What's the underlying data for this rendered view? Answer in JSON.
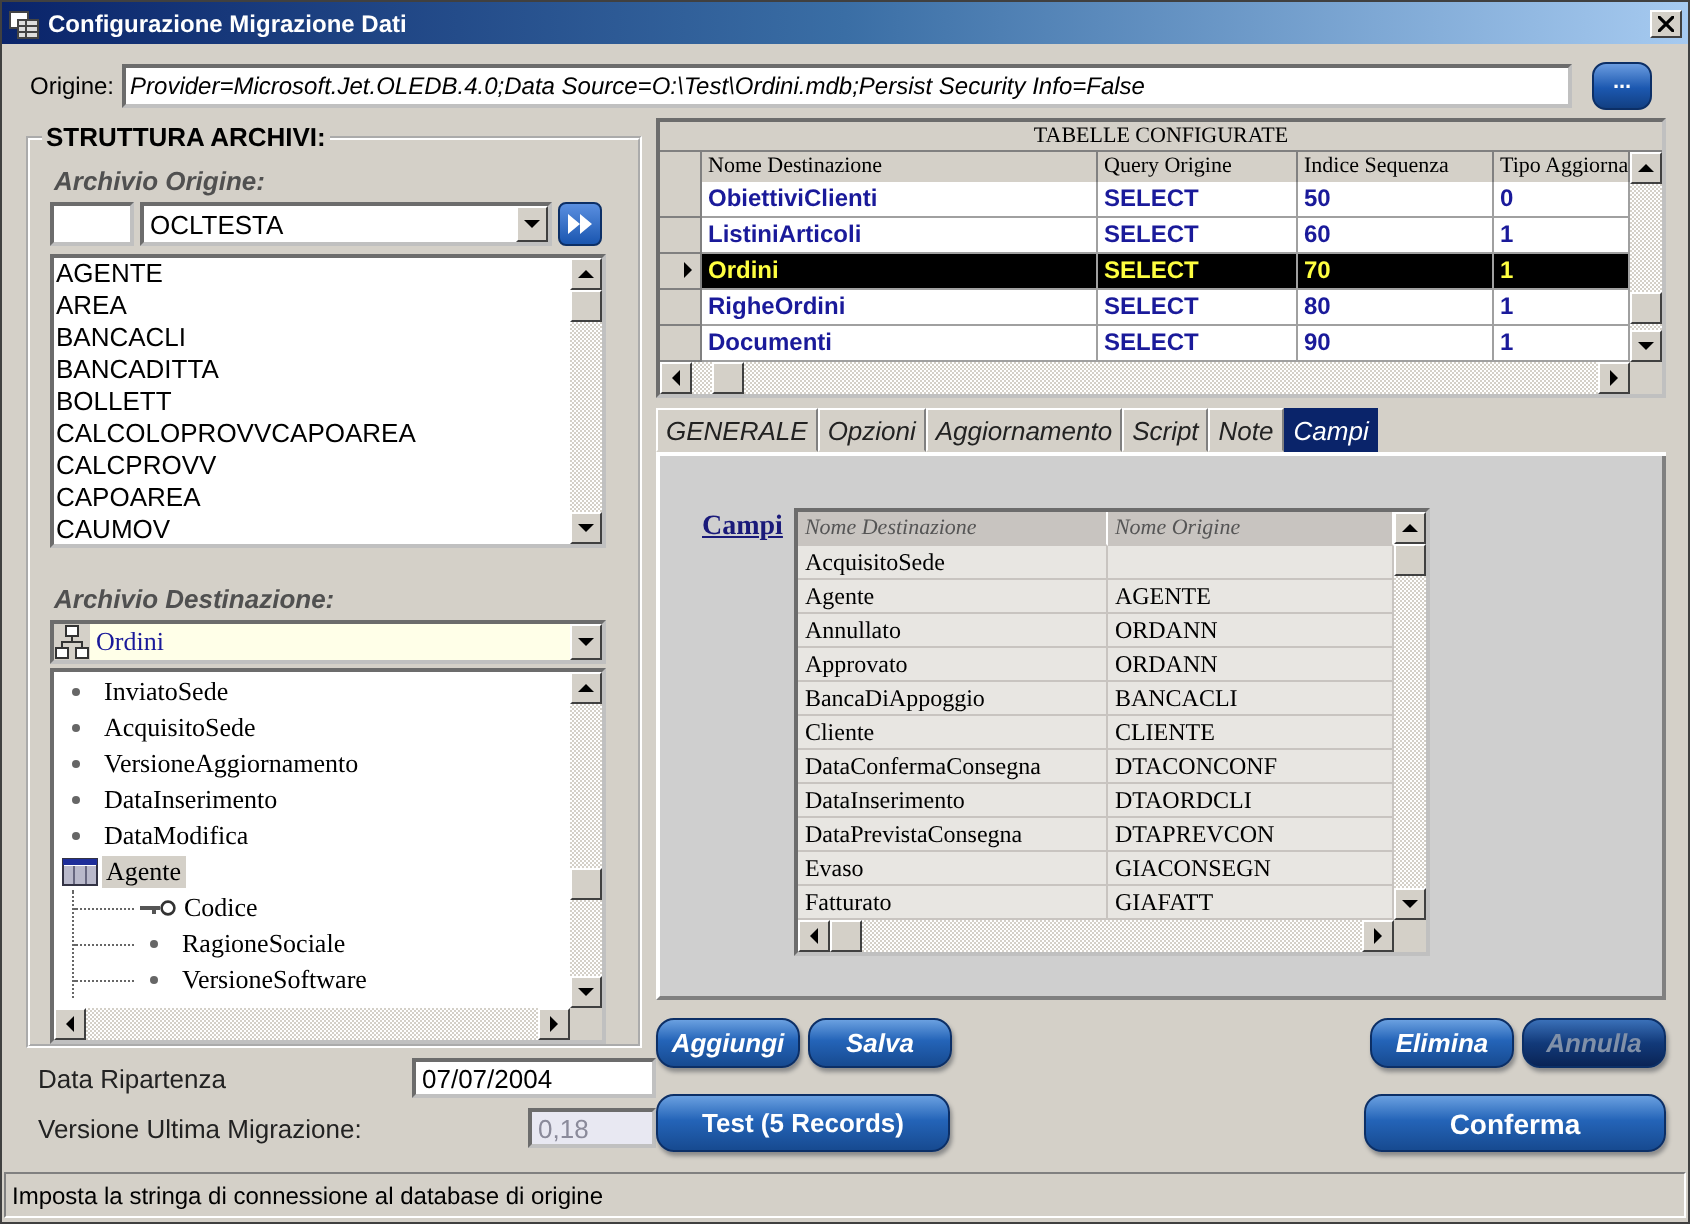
{
  "window": {
    "title": "Configurazione Migrazione Dati"
  },
  "origine": {
    "label": "Origine:",
    "value": "Provider=Microsoft.Jet.OLEDB.4.0;Data Source=O:\\Test\\Ordini.mdb;Persist Security Info=False",
    "button": "..."
  },
  "struttura": {
    "title": "STRUTTURA ARCHIVI:",
    "origine": {
      "label": "Archivio Origine:",
      "combo": "OCLTESTA",
      "items": [
        "AGENTE",
        "AREA",
        "BANCACLI",
        "BANCADITTA",
        "BOLLETT",
        "CALCOLOPROVVCAPOAREA",
        "CALCPROVV",
        "CAPOAREA",
        "CAUMOV"
      ]
    },
    "destinazione": {
      "label": "Archivio Destinazione:",
      "combo": "Ordini",
      "tree": [
        {
          "kind": "field",
          "label": "InviatoSede",
          "selected": false
        },
        {
          "kind": "field",
          "label": "AcquisitoSede",
          "selected": false
        },
        {
          "kind": "field",
          "label": "VersioneAggiornamento",
          "selected": false
        },
        {
          "kind": "field",
          "label": "DataInserimento",
          "selected": false
        },
        {
          "kind": "field",
          "label": "DataModifica",
          "selected": false
        },
        {
          "kind": "table",
          "label": "Agente",
          "selected": true,
          "children": [
            {
              "kind": "key",
              "label": "Codice",
              "selected": false
            },
            {
              "kind": "field",
              "label": "RagioneSociale",
              "selected": false
            },
            {
              "kind": "field",
              "label": "VersioneSoftware",
              "selected": false
            }
          ]
        }
      ]
    }
  },
  "data_ripartenza": {
    "label": "Data Ripartenza",
    "value": "07/07/2004"
  },
  "versione": {
    "label": "Versione Ultima Migrazione:",
    "value": "0,18",
    "disabled": true
  },
  "tabelle": {
    "title": "TABELLE CONFIGURATE",
    "columns": [
      "Nome Destinazione",
      "Query Origine",
      "Indice Sequenza",
      "Tipo Aggiorna"
    ],
    "rows": [
      {
        "cells": [
          "ObiettiviClienti",
          "SELECT",
          "50",
          "0"
        ],
        "selected": false
      },
      {
        "cells": [
          "ListiniArticoli",
          "SELECT",
          "60",
          "1"
        ],
        "selected": false
      },
      {
        "cells": [
          "Ordini",
          "SELECT",
          "70",
          "1"
        ],
        "selected": true
      },
      {
        "cells": [
          "RigheOrdini",
          "SELECT",
          "80",
          "1"
        ],
        "selected": false
      },
      {
        "cells": [
          "Documenti",
          "SELECT",
          "90",
          "1"
        ],
        "selected": false
      }
    ]
  },
  "tabs": [
    {
      "label": "GENERALE",
      "selected": false
    },
    {
      "label": "Opzioni",
      "selected": false
    },
    {
      "label": "Aggiornamento",
      "selected": false
    },
    {
      "label": "Script",
      "selected": false
    },
    {
      "label": "Note",
      "selected": false
    },
    {
      "label": "Campi",
      "selected": true
    }
  ],
  "campi": {
    "label": "Campi",
    "columns": [
      "Nome Destinazione",
      "Nome Origine"
    ],
    "rows": [
      {
        "destinazione": "AcquisitoSede"
      },
      {
        "destinazione": "Agente",
        "origine": "AGENTE"
      },
      {
        "destinazione": "Annullato",
        "origine": "ORDANN"
      },
      {
        "destinazione": "Approvato",
        "origine": "ORDANN"
      },
      {
        "destinazione": "BancaDiAppoggio",
        "origine": "BANCACLI"
      },
      {
        "destinazione": "Cliente",
        "origine": "CLIENTE"
      },
      {
        "destinazione": "DataConfermaConsegna",
        "origine": "DTACONCONF"
      },
      {
        "destinazione": "DataInserimento",
        "origine": "DTAORDCLI"
      },
      {
        "destinazione": "DataPrevistaConsegna",
        "origine": "DTAPREVCON"
      },
      {
        "destinazione": "Evaso",
        "origine": "GIACONSEGN"
      },
      {
        "destinazione": "Fatturato",
        "origine": "GIAFATT"
      }
    ]
  },
  "buttons_left": [
    {
      "label": "Aggiungi",
      "kind": "small",
      "disabled": false
    },
    {
      "label": "Salva",
      "kind": "small",
      "disabled": false
    },
    {
      "label": "Test (5 Records)",
      "kind": "large",
      "disabled": false
    }
  ],
  "buttons_right": [
    {
      "label": "Elimina",
      "kind": "small",
      "disabled": false
    },
    {
      "label": "Annulla",
      "kind": "small",
      "disabled": true
    },
    {
      "label": "Conferma",
      "kind": "large",
      "disabled": false
    }
  ],
  "status_bar": "Imposta la stringa di connessione al database di origine"
}
